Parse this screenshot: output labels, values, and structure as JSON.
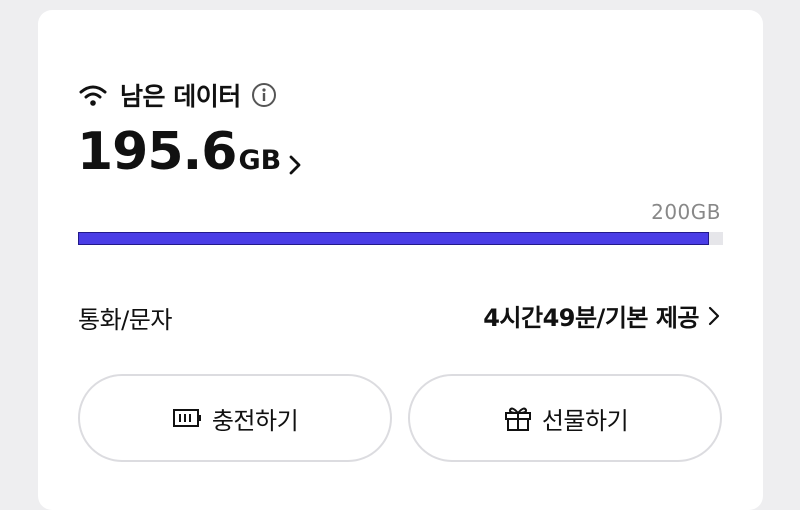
{
  "data_card": {
    "title": "남은 데이터",
    "remaining_value": "195.6",
    "remaining_unit": "GB",
    "total_label": "200GB",
    "usage_fraction": 0.978,
    "accent_color": "#4a3de6"
  },
  "voice_row": {
    "label": "통화/문자",
    "value": "4시간49분/기본 제공"
  },
  "buttons": {
    "charge_label": "충전하기",
    "gift_label": "선물하기"
  },
  "icons": {
    "title": "wifi-icon",
    "info": "info-icon",
    "charge": "battery-charge-icon",
    "gift": "gift-icon",
    "chevron": "chevron-right-icon"
  }
}
